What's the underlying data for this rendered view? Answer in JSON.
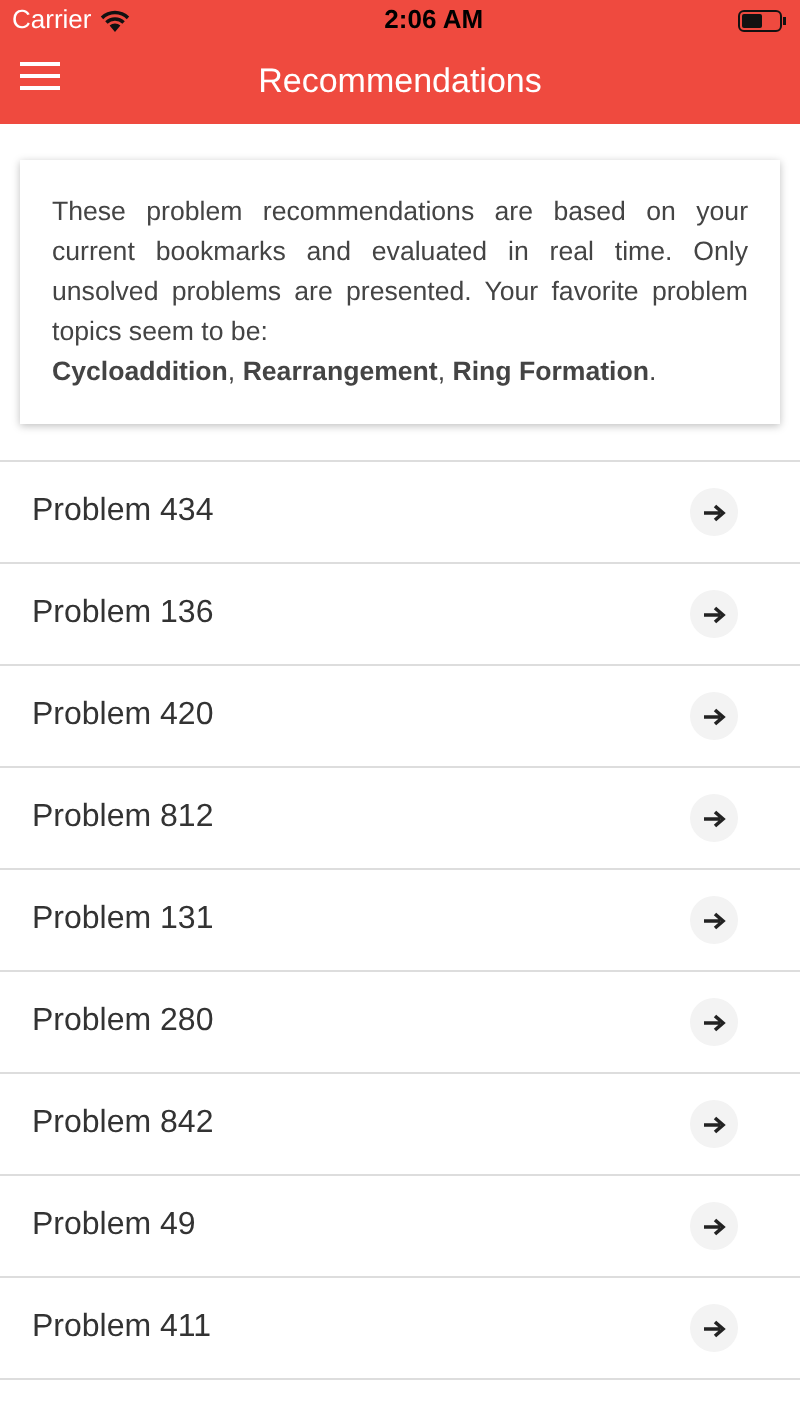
{
  "status_bar": {
    "carrier": "Carrier",
    "time": "2:06 AM"
  },
  "nav_bar": {
    "title": "Recommendations"
  },
  "info_card": {
    "text": "These problem recommendations are based on your current bookmarks and evaluated in real time. Only unsolved problems are presented. Your favorite problem topics seem to be:",
    "topics": "**Cycloaddition**, **Rearrangement**, **Ring Formation**."
  },
  "problems": [
    {
      "label": "Problem 434"
    },
    {
      "label": "Problem 136"
    },
    {
      "label": "Problem 420"
    },
    {
      "label": "Problem 812"
    },
    {
      "label": "Problem 131"
    },
    {
      "label": "Problem 280"
    },
    {
      "label": "Problem 842"
    },
    {
      "label": "Problem 49"
    },
    {
      "label": "Problem 411"
    }
  ]
}
